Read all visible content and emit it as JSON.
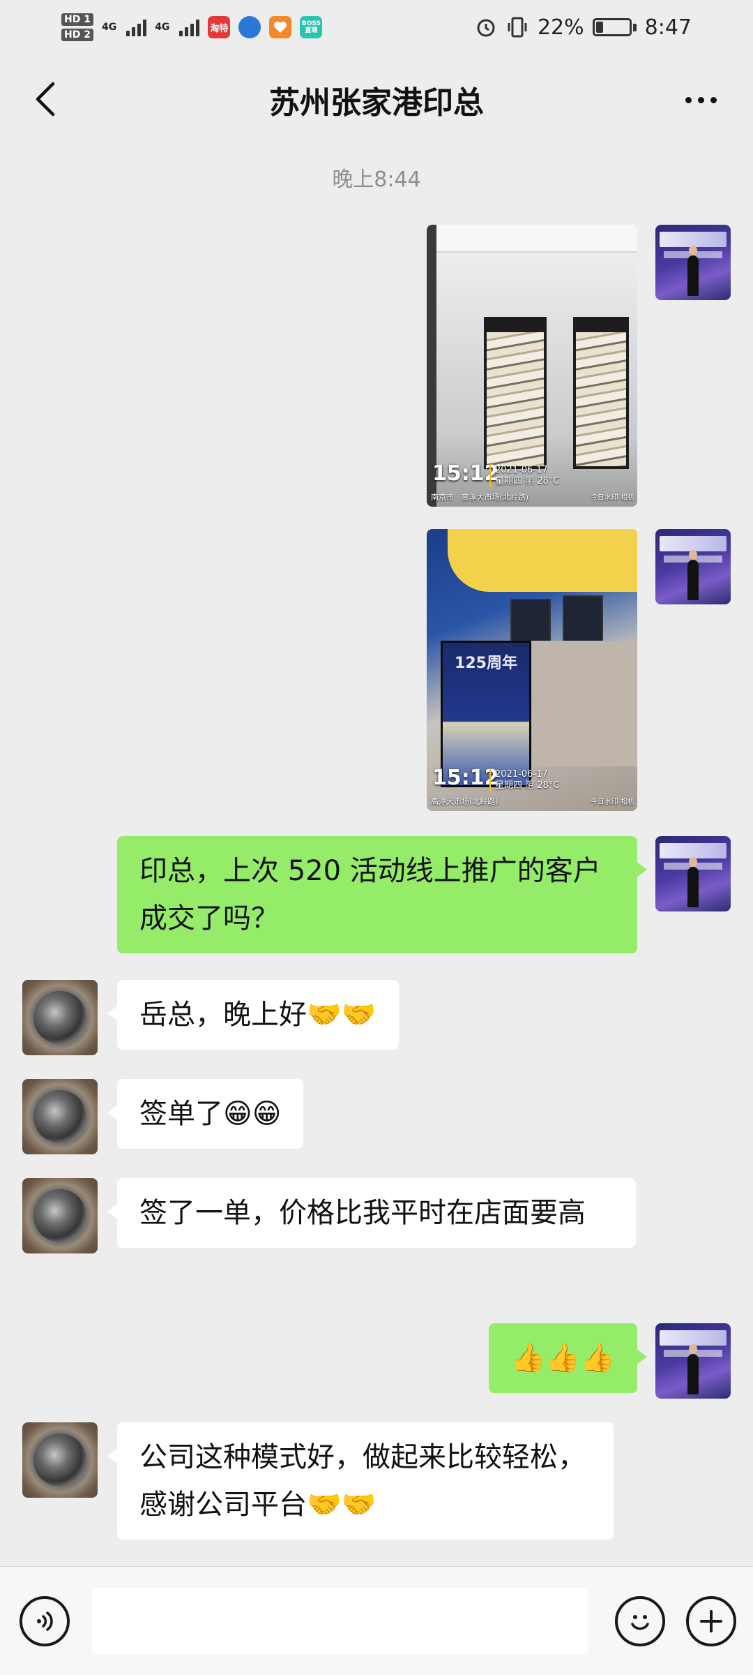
{
  "status_bar": {
    "hd1": "HD 1",
    "hd2": "HD 2",
    "net1": "4G",
    "net2": "4G",
    "app_icons": [
      {
        "name": "taobao-icon",
        "label": "淘特",
        "color": "#e4393c"
      },
      {
        "name": "browser-icon",
        "label": "",
        "color": "#2b76d9"
      },
      {
        "name": "health-icon",
        "label": "",
        "color": "#f28a2b"
      },
      {
        "name": "boss-icon",
        "label": "BOSS直聘",
        "color": "#2bc4b0"
      }
    ],
    "battery": "22%",
    "battery_level": 0.22,
    "time": "8:47"
  },
  "header": {
    "title": "苏州张家港印总"
  },
  "timestamp": "晚上8:44",
  "photos": {
    "p1": {
      "time": "15:12",
      "date": "2021-06-17",
      "weather": "星期四 阴 28°C",
      "location": "南京市 · 高淳大市场(北岭路)",
      "watermark": "今日水印 相机"
    },
    "p2": {
      "time": "15:12",
      "date": "2021-06-17",
      "weather": "星期四 阴 28°C",
      "location": "高淳大市场(北岭路)",
      "watermark": "今日水印 相机",
      "standee_text": "125周年"
    }
  },
  "messages": {
    "m1": "印总，上次 520 活动线上推广的客户成交了吗？",
    "m2": "岳总，晚上好🤝🤝",
    "m3": "签单了😁😁",
    "m4": "签了一单，价格比我平时在店面要高",
    "m5": "👍👍👍",
    "m6": "公司这种模式好，做起来比较轻松，感谢公司平台🤝🤝"
  },
  "input": {
    "value": ""
  }
}
